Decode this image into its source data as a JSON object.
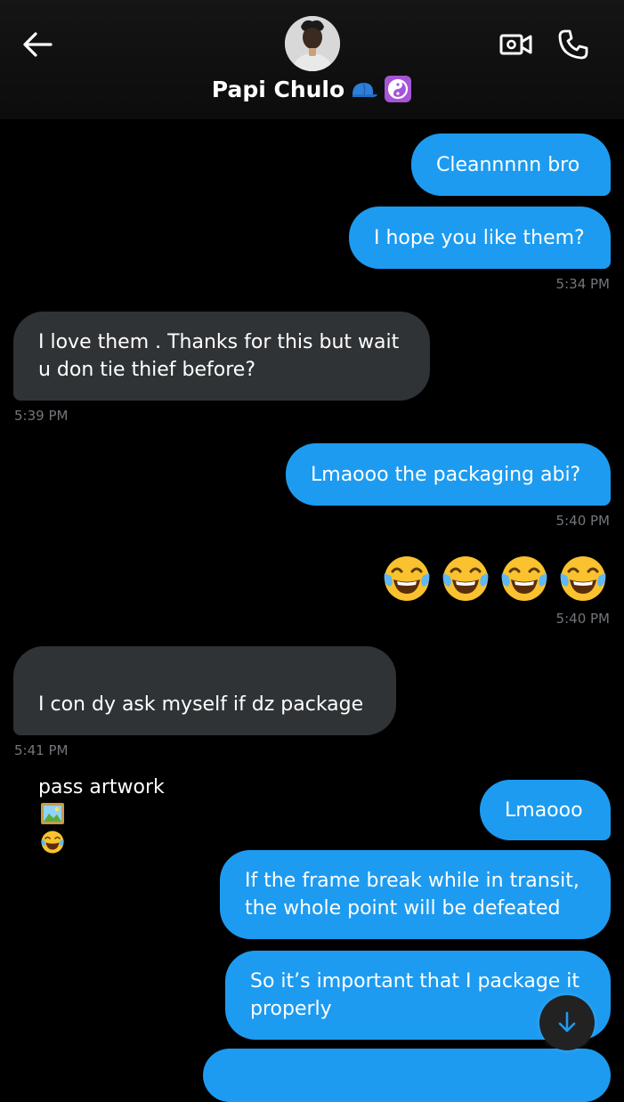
{
  "header": {
    "contact_name": "Papi Chulo",
    "name_emojis": "🧢 ☯️"
  },
  "messages": [
    {
      "id": "m1",
      "direction": "sent",
      "text": "Cleannnnn bro"
    },
    {
      "id": "m2",
      "direction": "sent",
      "text": "I hope you like them?",
      "timestamp": "5:34 PM"
    },
    {
      "id": "m3",
      "direction": "received",
      "text": "I love them . Thanks for this but wait\nu don tie thief before?",
      "timestamp": "5:39 PM"
    },
    {
      "id": "m4",
      "direction": "sent",
      "text": "Lmaooo the packaging abi?",
      "timestamp": "5:40 PM"
    },
    {
      "id": "m5",
      "direction": "sent",
      "text": "😂😂😂😂",
      "emoji_count": 4,
      "emoji_name": "face-with-tears-of-joy",
      "timestamp": "5:40 PM"
    },
    {
      "id": "m6",
      "direction": "received",
      "line1": "I con dy ask myself if dz package",
      "line2": "pass artwork",
      "trailing_emojis": [
        "framed-picture",
        "face-with-tears-of-joy"
      ],
      "timestamp": "5:41 PM"
    },
    {
      "id": "m7",
      "direction": "sent",
      "text": "Lmaooo"
    },
    {
      "id": "m8",
      "direction": "sent",
      "text": "If the frame break while in transit,\nthe whole point will be defeated"
    },
    {
      "id": "m9",
      "direction": "sent",
      "text": "So it’s important that I package it\nproperly"
    }
  ],
  "colors": {
    "background": "#000000",
    "sent_bubble": "#1d9bf0",
    "received_bubble": "#2f3336",
    "timestamp": "#71767b"
  },
  "icons": {
    "back": "arrow-left-icon",
    "video": "video-camera-icon",
    "call": "phone-icon",
    "scroll": "arrow-down-icon"
  }
}
